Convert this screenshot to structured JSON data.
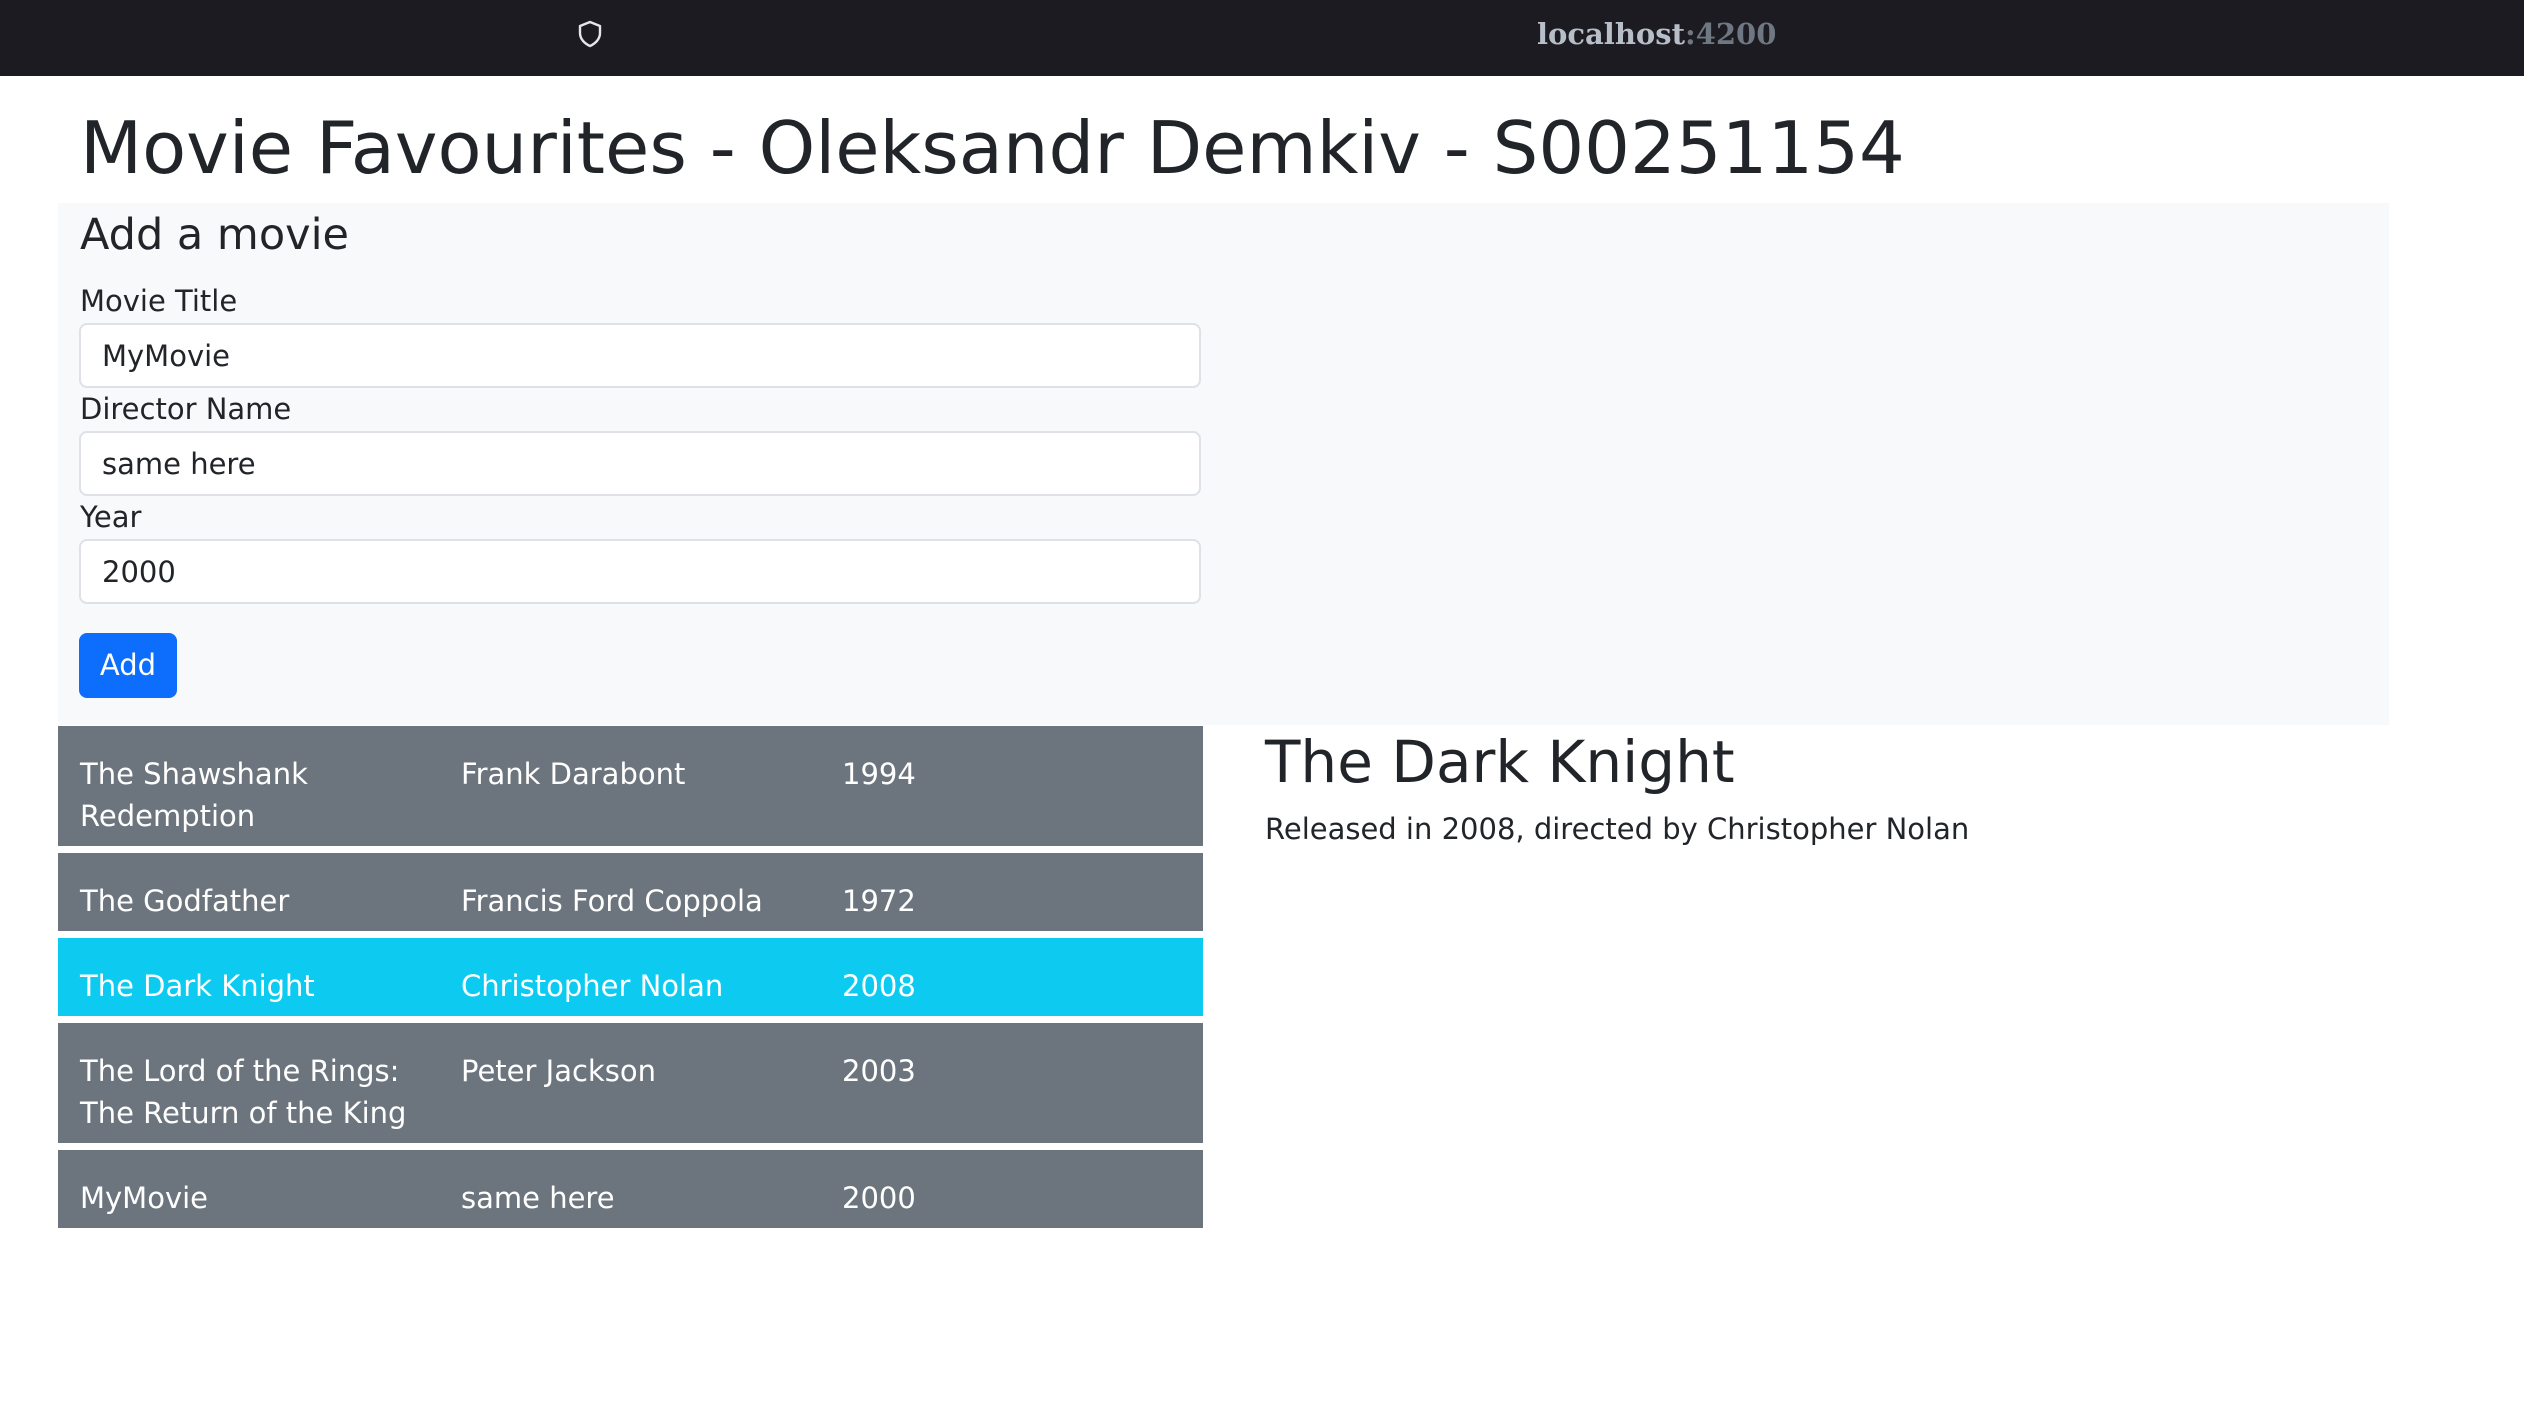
{
  "browser": {
    "url_host": "localhost",
    "url_port": ":4200",
    "icons": {
      "security": "shield-icon"
    }
  },
  "page": {
    "title": "Movie Favourites - Oleksandr Demkiv - S00251154"
  },
  "add_form": {
    "heading": "Add a movie",
    "title_label": "Movie Title",
    "title_value": "MyMovie",
    "director_label": "Director Name",
    "director_value": "same here",
    "year_label": "Year",
    "year_value": "2000",
    "add_button_label": "Add"
  },
  "movies": [
    {
      "title": "The Shawshank Redemption",
      "director": "Frank Darabont",
      "year": "1994",
      "selected": false
    },
    {
      "title": "The Godfather",
      "director": "Francis Ford Coppola",
      "year": "1972",
      "selected": false
    },
    {
      "title": "The Dark Knight",
      "director": "Christopher Nolan",
      "year": "2008",
      "selected": true
    },
    {
      "title": "The Lord of the Rings: The Return of the King",
      "director": "Peter Jackson",
      "year": "2003",
      "selected": false
    },
    {
      "title": "MyMovie",
      "director": "same here",
      "year": "2000",
      "selected": false
    }
  ],
  "details": {
    "title": "The Dark Knight",
    "description": "Released in 2008, directed by Christopher Nolan"
  },
  "colors": {
    "topbar": "#1c1b22",
    "row_default": "#6c757d",
    "row_selected": "#0dcaf0",
    "primary_button": "#0d6efd",
    "panel_background": "#f8f9fa"
  }
}
